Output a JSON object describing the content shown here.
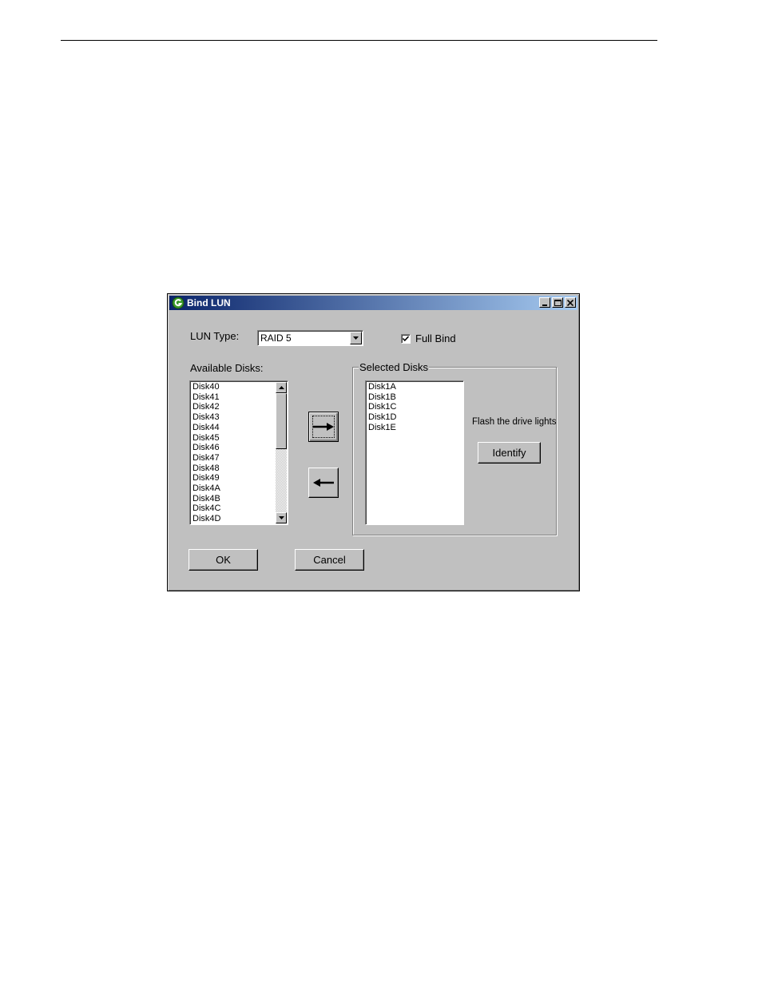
{
  "window": {
    "title": "Bind LUN",
    "icon": "app-logo-icon",
    "controls": [
      "minimize-icon",
      "maximize-icon",
      "close-icon"
    ]
  },
  "lun_type": {
    "label": "LUN Type:",
    "value": "RAID 5"
  },
  "full_bind": {
    "label": "Full Bind",
    "checked": true
  },
  "available": {
    "label": "Available Disks:",
    "items": [
      "Disk40",
      "Disk41",
      "Disk42",
      "Disk43",
      "Disk44",
      "Disk45",
      "Disk46",
      "Disk47",
      "Disk48",
      "Disk49",
      "Disk4A",
      "Disk4B",
      "Disk4C",
      "Disk4D"
    ]
  },
  "selected": {
    "label": "Selected Disks",
    "items": [
      "Disk1A",
      "Disk1B",
      "Disk1C",
      "Disk1D",
      "Disk1E"
    ]
  },
  "flash": {
    "text": "Flash the drive lights",
    "button": "Identify"
  },
  "buttons": {
    "ok": "OK",
    "cancel": "Cancel",
    "add_icon": "arrow-right-icon",
    "remove_icon": "arrow-left-icon"
  }
}
